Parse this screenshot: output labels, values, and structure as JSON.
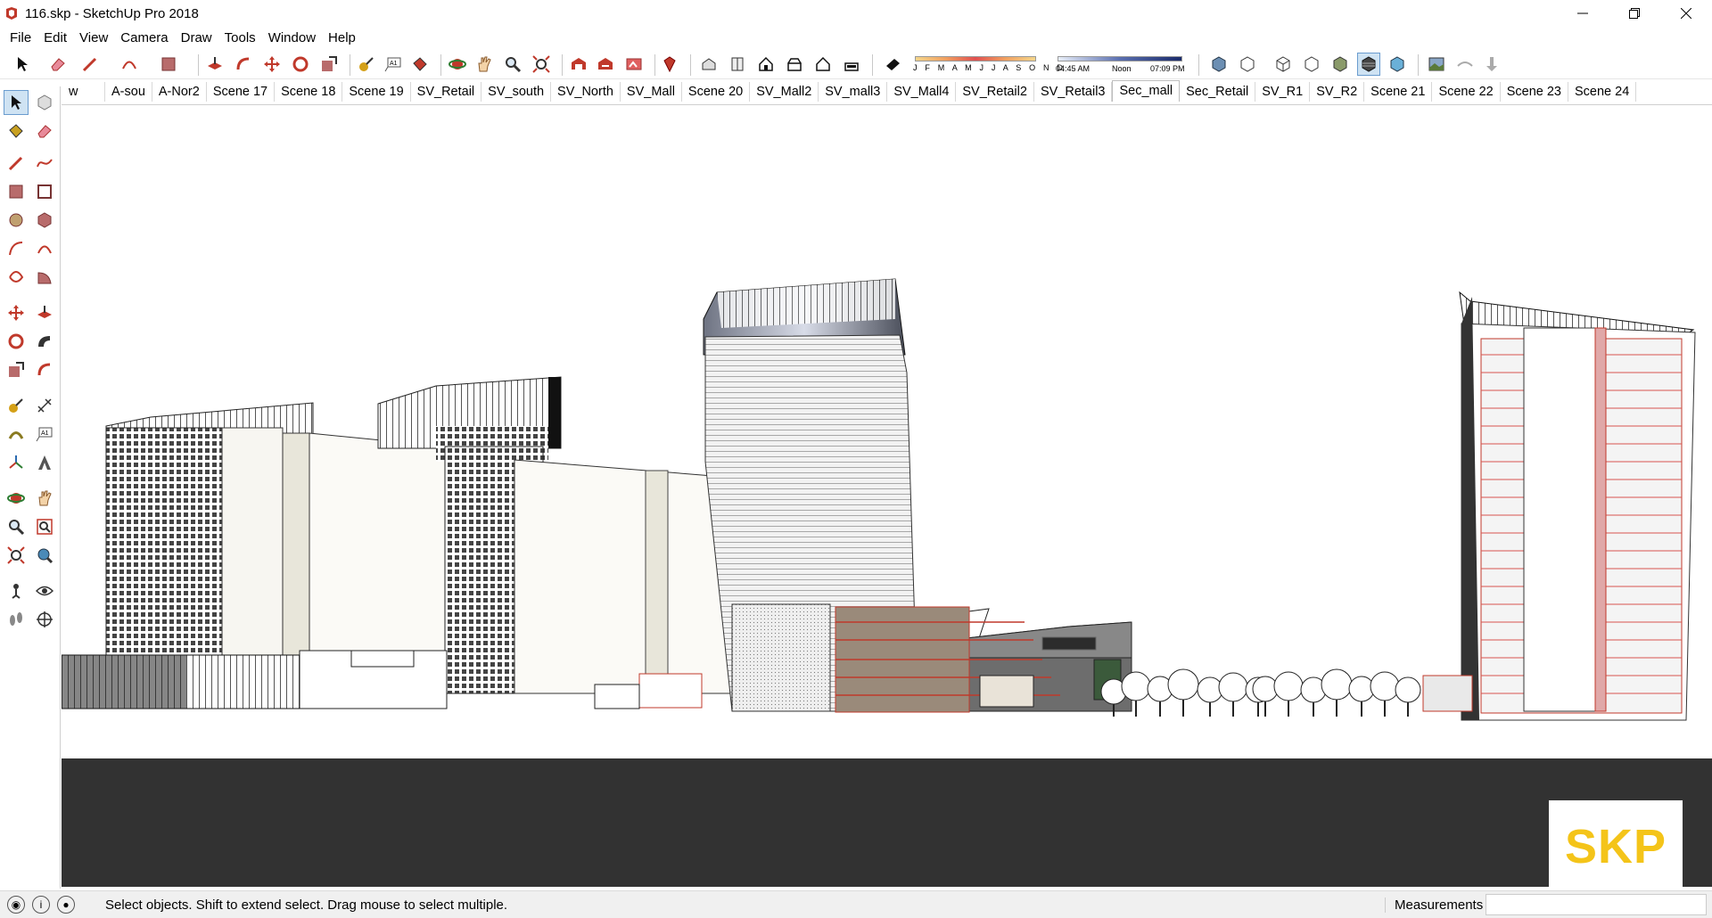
{
  "window": {
    "title": "116.skp - SketchUp Pro 2018"
  },
  "menu": {
    "items": [
      "File",
      "Edit",
      "View",
      "Camera",
      "Draw",
      "Tools",
      "Window",
      "Help"
    ]
  },
  "shadow_settings": {
    "months": "J F M A M J J A S O N D",
    "time_start": "04:45 AM",
    "time_mid": "Noon",
    "time_end": "07:09 PM"
  },
  "scenes": {
    "tabs": [
      "w",
      "A-sou",
      "A-Nor2",
      "Scene 17",
      "Scene 18",
      "Scene 19",
      "SV_Retail",
      "SV_south",
      "SV_North",
      "SV_Mall",
      "Scene 20",
      "SV_Mall2",
      "SV_mall3",
      "SV_Mall4",
      "SV_Retail2",
      "SV_Retail3",
      "Sec_mall",
      "Sec_Retail",
      "SV_R1",
      "SV_R2",
      "Scene 21",
      "Scene 22",
      "Scene 23",
      "Scene 24"
    ],
    "active": "Sec_mall"
  },
  "logo": {
    "text": "SKP",
    "color": "#f4c419"
  },
  "statusbar": {
    "hint": "Select objects. Shift to extend select. Drag mouse to select multiple.",
    "measurements_label": "Measurements",
    "measurements_value": ""
  },
  "colors": {
    "ground": "#323232",
    "section_cut": "#d9534f",
    "toolbar_accent": "#c0392b"
  }
}
